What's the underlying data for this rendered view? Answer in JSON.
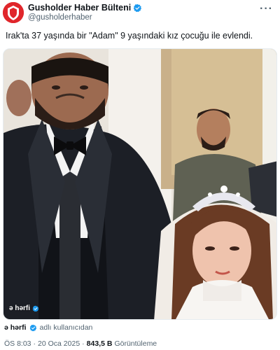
{
  "header": {
    "display_name": "Gusholder Haber Bülteni",
    "handle": "@gusholderhaber",
    "more_label": "···",
    "avatar_icon": "red-shield-logo-icon",
    "verified_icon": "verified-badge-icon",
    "verified_color": "#1d9bf0"
  },
  "tweet": {
    "text": "Irak'ta 37 yaşında bir \"Adam\" 9 yaşındaki kız çocuğu ile evlendi."
  },
  "media": {
    "watermark_text": "ə hərfi",
    "watermark_badge_icon": "verified-badge-icon"
  },
  "source": {
    "name": "ə hərfi",
    "badge_icon": "verified-badge-icon",
    "label": "adlı kullanıcıdan"
  },
  "meta": {
    "time": "ÖS 8:03",
    "separator1": "·",
    "date": "20 Oca 2025",
    "separator2": "·",
    "views_count": "843,5 B",
    "views_label": "Görüntüleme"
  }
}
